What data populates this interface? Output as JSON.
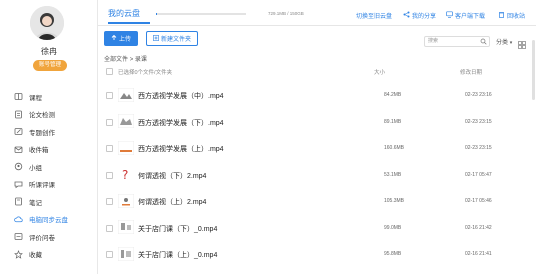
{
  "user": {
    "name": "徐冉",
    "badge": "账号管理"
  },
  "sidebar": {
    "items": [
      {
        "label": "课程",
        "icon": "book-icon",
        "active": false
      },
      {
        "label": "论文检测",
        "icon": "document-check-icon",
        "active": false
      },
      {
        "label": "专题创作",
        "icon": "edit-icon",
        "active": false
      },
      {
        "label": "收件箱",
        "icon": "inbox-icon",
        "active": false
      },
      {
        "label": "小组",
        "icon": "group-icon",
        "active": false
      },
      {
        "label": "听课评课",
        "icon": "comment-icon",
        "active": false
      },
      {
        "label": "笔记",
        "icon": "note-icon",
        "active": false
      },
      {
        "label": "电脑同步云盘",
        "icon": "cloud-icon",
        "active": true
      },
      {
        "label": "评价问卷",
        "icon": "survey-icon",
        "active": false
      },
      {
        "label": "收藏",
        "icon": "star-icon",
        "active": false
      }
    ]
  },
  "header": {
    "tab": "我的云盘",
    "quota_text": "729.1MB / 150GB",
    "quota_fraction": 0.005,
    "links": [
      "切换至旧云盘",
      "我的分享",
      "客户端下载",
      "回收站"
    ]
  },
  "toolbar": {
    "upload": "上传",
    "new_folder": "新建文件夹",
    "search_placeholder": "搜索",
    "sort_label": "分类"
  },
  "breadcrumb": {
    "root": "全部文件",
    "sep": ">",
    "current": "录课"
  },
  "list": {
    "header_select": "已选择0个文件/文件夹",
    "col_size": "大小",
    "col_date": "修改日期",
    "files": [
      {
        "name": "西方透视学发展（中）.mp4",
        "size": "84.2MB",
        "date": "02-23 23:16"
      },
      {
        "name": "西方透视学发展（下）.mp4",
        "size": "89.1MB",
        "date": "02-23 23:15"
      },
      {
        "name": "西方透视学发展（上）.mp4",
        "size": "160.6MB",
        "date": "02-23 23:15"
      },
      {
        "name": "何谓透视（下）2.mp4",
        "size": "53.1MB",
        "date": "02-17 05:47"
      },
      {
        "name": "何谓透视（上）2.mp4",
        "size": "105.3MB",
        "date": "02-17 05:46"
      },
      {
        "name": "关于店门课（下）_0.mp4",
        "size": "99.0MB",
        "date": "02-16 21:42"
      },
      {
        "name": "关于店门课（上）_0.mp4",
        "size": "95.8MB",
        "date": "02-16 21:41"
      }
    ]
  },
  "colors": {
    "accent": "#2f83e4",
    "vip": "#f0a43c"
  }
}
